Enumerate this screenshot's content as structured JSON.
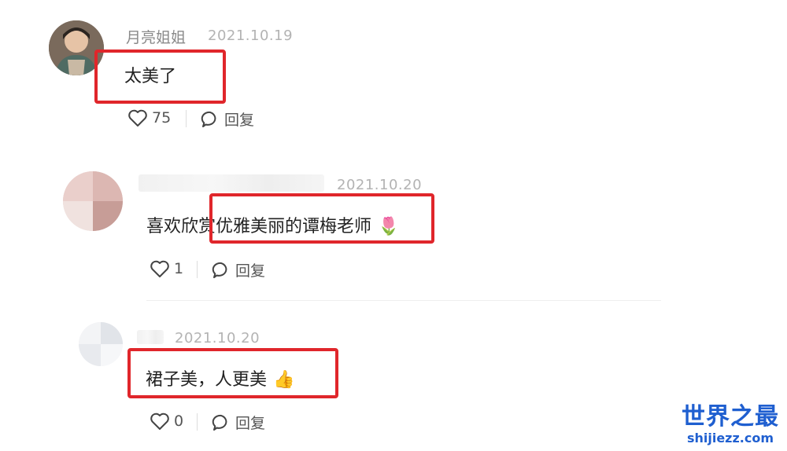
{
  "comments": [
    {
      "username": "月亮姐姐",
      "date": "2021.10.19",
      "text": "太美了",
      "likes": "75",
      "reply_label": "回复"
    },
    {
      "username": "",
      "date": "2021.10.20",
      "text": "喜欢欣赏优雅美丽的谭梅老师",
      "emoji": "🌷",
      "likes": "1",
      "reply_label": "回复"
    },
    {
      "username": "",
      "date": "2021.10.20",
      "text": "裙子美，人更美",
      "emoji": "👍",
      "likes": "0",
      "reply_label": "回复"
    }
  ],
  "watermark": {
    "title": "世界之最",
    "url": "shijiezz.com"
  },
  "colors": {
    "highlight_box": "#e0262b",
    "watermark": "#1f5fd0",
    "date": "#b3b3b3"
  }
}
